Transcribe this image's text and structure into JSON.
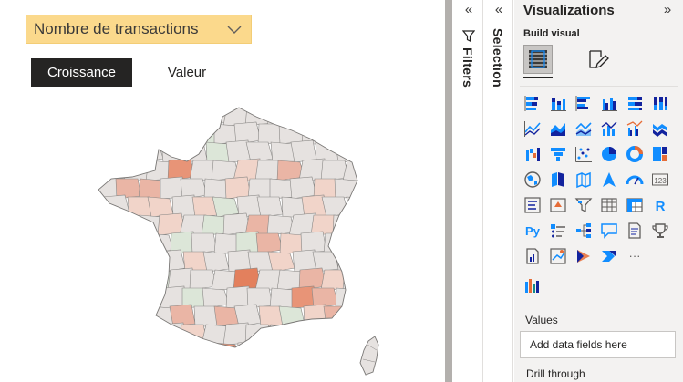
{
  "canvas": {
    "slicer": {
      "selected": "Nombre de transactions"
    },
    "buttons": {
      "active": "Croissance",
      "inactive": "Valeur"
    },
    "map": {
      "fill_palette": [
        "#e6e2e0",
        "#dce6d8",
        "#f1d4c9",
        "#eab5a5",
        "#e89477",
        "#e3805d"
      ]
    }
  },
  "filters_pane": {
    "collapse_glyph": "«",
    "label": "Filters"
  },
  "selection_pane": {
    "collapse_glyph": "«",
    "label": "Selection"
  },
  "visualizations": {
    "title": "Visualizations",
    "expand_glyph": "»",
    "build_visual_label": "Build visual",
    "tabs": [
      "build-visual-tab",
      "format-visual-tab"
    ],
    "icons": [
      [
        "stacked-bar-chart-icon",
        "stacked-column-chart-icon",
        "clustered-bar-chart-icon",
        "clustered-column-chart-icon",
        "100-percent-stacked-bar-icon",
        "100-percent-stacked-column-icon"
      ],
      [
        "line-chart-icon",
        "area-chart-icon",
        "stacked-area-chart-icon",
        "line-and-stacked-column-icon",
        "line-and-clustered-column-icon",
        "ribbon-chart-icon"
      ],
      [
        "waterfall-chart-icon",
        "funnel-chart-icon",
        "scatter-chart-icon",
        "pie-chart-icon",
        "donut-chart-icon",
        "treemap-icon"
      ],
      [
        "map-icon",
        "filled-map-icon",
        "shape-map-icon",
        "azure-map-icon",
        "gauge-icon",
        "card-icon"
      ],
      [
        "multi-row-card-icon",
        "kpi-icon",
        "slicer-icon",
        "table-icon",
        "matrix-icon",
        "r-visual-icon"
      ],
      [
        "python-visual-icon",
        "key-influencers-icon",
        "decomposition-tree-icon",
        "qa-icon",
        "smart-narrative-icon",
        "goals-icon"
      ],
      [
        "paginated-report-icon",
        "arcgis-map-icon",
        "power-apps-icon",
        "power-automate-icon",
        "more-visuals-icon"
      ]
    ],
    "glyphs": {
      "card": "123",
      "r": "R",
      "python": "Py",
      "more": "···"
    },
    "custom_icon": "custom-visual-icon",
    "colors": {
      "blue": "#118dff",
      "dark_blue": "#12239e",
      "orange": "#e66c37",
      "teal": "#0f8a8a",
      "gray": "#605e5c"
    },
    "values_label": "Values",
    "values_placeholder": "Add data fields here",
    "drill_label": "Drill through"
  }
}
